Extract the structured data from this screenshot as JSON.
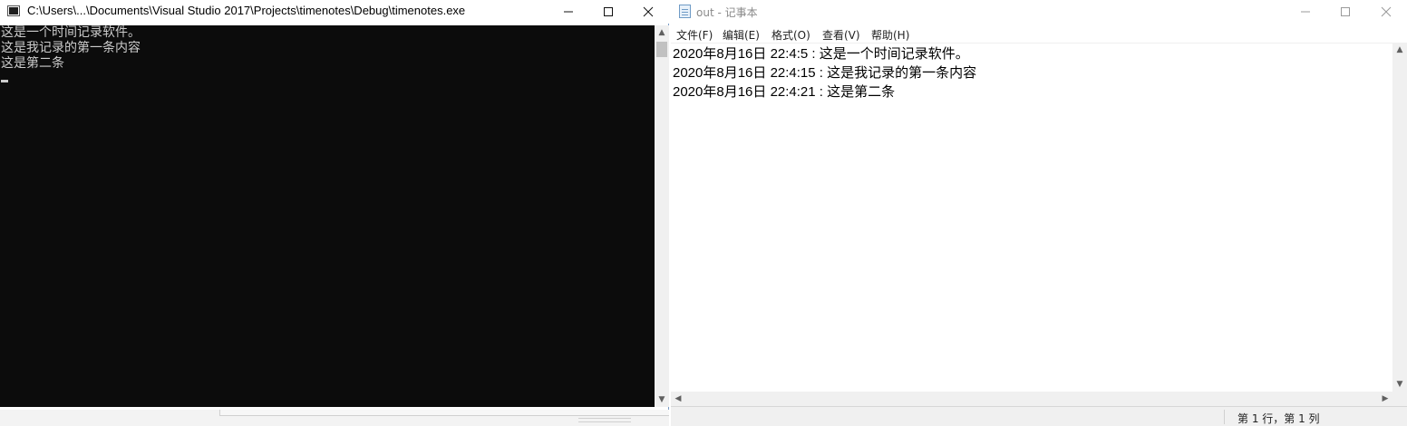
{
  "console": {
    "title": "C:\\Users\\...\\Documents\\Visual Studio 2017\\Projects\\timenotes\\Debug\\timenotes.exe",
    "lines": [
      "这是一个时间记录软件。",
      "这是我记录的第一条内容",
      "这是第二条"
    ],
    "icons": {
      "app": "console-app-icon",
      "minimize": "minimize-icon",
      "maximize": "maximize-icon",
      "close": "close-icon"
    }
  },
  "notepad": {
    "title": "out - 记事本",
    "menu": [
      "文件(F)",
      "编辑(E)",
      "格式(O)",
      "查看(V)",
      "帮助(H)"
    ],
    "lines": [
      "2020年8月16日 22:4:5 : 这是一个时间记录软件。",
      "2020年8月16日 22:4:15 : 这是我记录的第一条内容",
      "2020年8月16日 22:4:21 : 这是第二条"
    ],
    "status_position": "第 1 行，第 1 列",
    "icons": {
      "app": "notepad-icon",
      "minimize": "minimize-icon",
      "maximize": "maximize-icon",
      "close": "close-icon"
    }
  }
}
